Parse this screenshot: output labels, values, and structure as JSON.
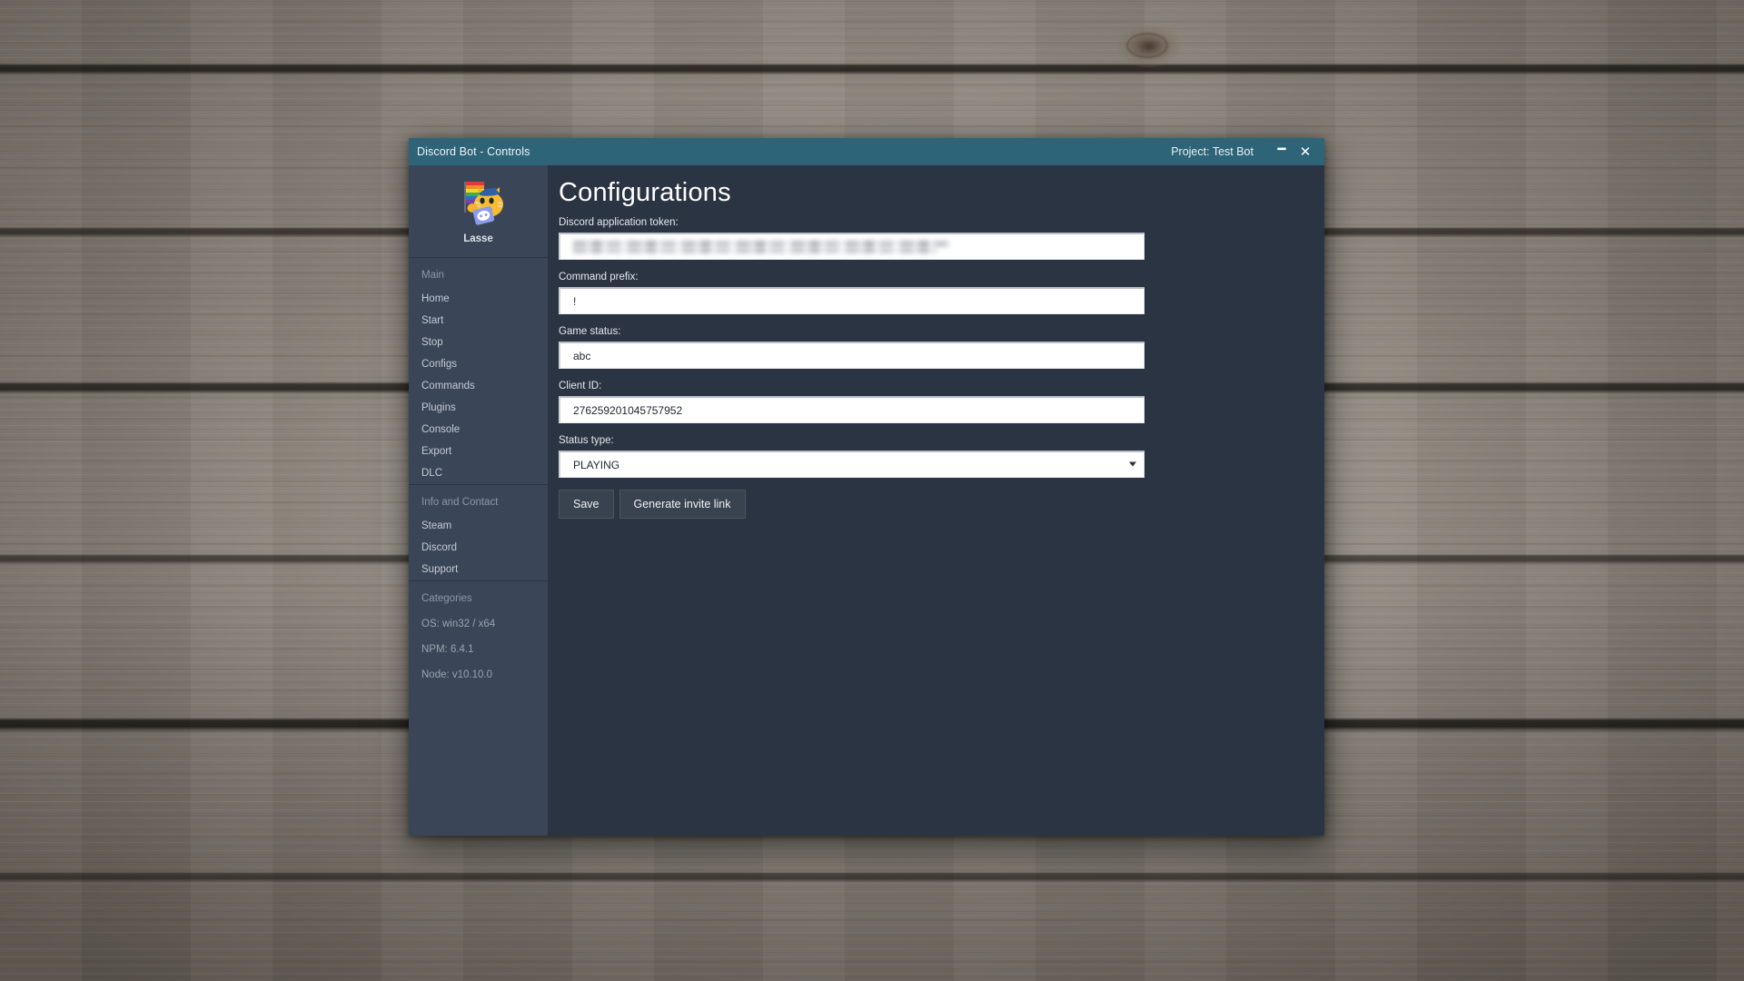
{
  "window": {
    "title": "Discord Bot - Controls",
    "project_label": "Project: Test Bot",
    "minimize_icon": "minimize-icon",
    "close_icon": "close-icon",
    "titlebar_color": "#2e6478",
    "sidebar_color": "#3a4557",
    "content_color": "#2b3442"
  },
  "sidebar": {
    "profile": {
      "name": "Lasse",
      "avatar_icon": "cat-pride-flag-discord-avatar"
    },
    "sections": [
      {
        "title": "Main",
        "items": [
          {
            "label": "Home"
          },
          {
            "label": "Start"
          },
          {
            "label": "Stop"
          },
          {
            "label": "Configs"
          },
          {
            "label": "Commands"
          },
          {
            "label": "Plugins"
          },
          {
            "label": "Console"
          },
          {
            "label": "Export"
          },
          {
            "label": "DLC"
          }
        ]
      },
      {
        "title": "Info and Contact",
        "items": [
          {
            "label": "Steam"
          },
          {
            "label": "Discord"
          },
          {
            "label": "Support"
          }
        ]
      }
    ],
    "categories": {
      "title": "Categories",
      "items": [
        {
          "label": "OS: win32 / x64"
        },
        {
          "label": "NPM: 6.4.1"
        },
        {
          "label": "Node: v10.10.0"
        }
      ]
    }
  },
  "main": {
    "page_title": "Configurations",
    "fields": [
      {
        "label": "Discord application token:",
        "value": "",
        "placeholder": "",
        "redacted": true,
        "name": "discord-application-token"
      },
      {
        "label": "Command prefix:",
        "value": "!",
        "placeholder": "",
        "name": "command-prefix"
      },
      {
        "label": "Game status:",
        "value": "abc",
        "placeholder": "",
        "name": "game-status"
      },
      {
        "label": "Client ID:",
        "value": "276259201045757952",
        "placeholder": "",
        "name": "client-id"
      }
    ],
    "status_type": {
      "label": "Status type:",
      "selected": "PLAYING",
      "arrow_icon": "chevron-down-icon"
    },
    "buttons": {
      "save": "Save",
      "generate_invite": "Generate invite link"
    }
  }
}
